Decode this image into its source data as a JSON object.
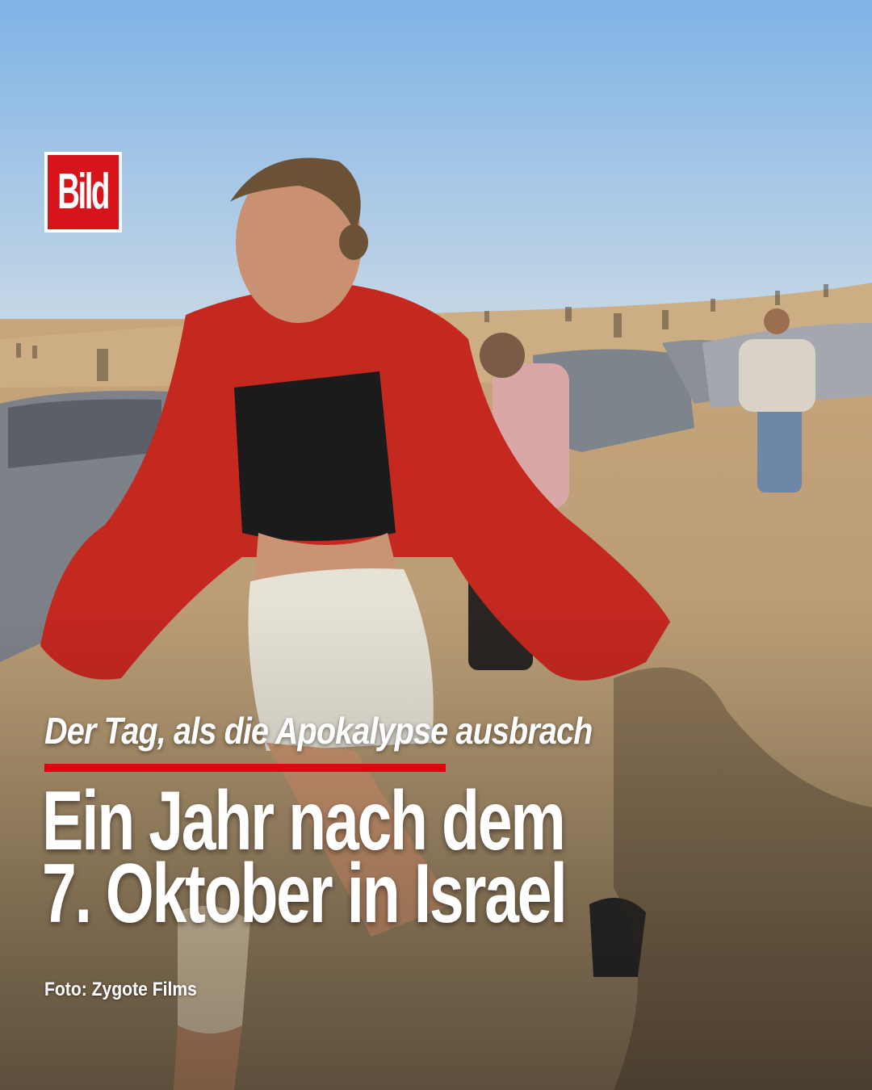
{
  "brand": {
    "logo_text": "Bild",
    "color": "#d7141a"
  },
  "article": {
    "kicker": "Der Tag, als die Apokalypse ausbrach",
    "headline_line1": "Ein Jahr nach dem",
    "headline_line2": "7. Oktober in Israel",
    "accent_color": "#e3000f"
  },
  "photo": {
    "credit": "Foto: Zygote Films"
  }
}
